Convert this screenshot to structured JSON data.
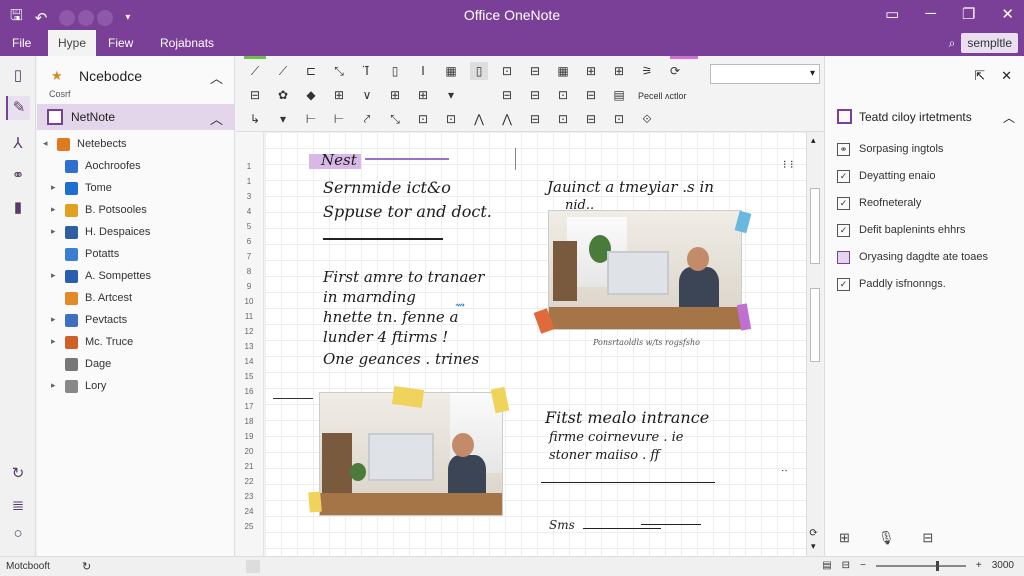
{
  "window": {
    "title": "Office OneNote",
    "qa_icons": [
      "save-icon",
      "undo-icon"
    ],
    "controls": [
      "restore-icon",
      "minimize-icon",
      "maximize-icon",
      "close-icon"
    ]
  },
  "menu": {
    "tabs": [
      {
        "label": "File",
        "active": false
      },
      {
        "label": "Hype",
        "active": true
      },
      {
        "label": "Fiew",
        "active": false
      },
      {
        "label": "Rojabnats",
        "active": false
      }
    ],
    "search_value": "sempltle"
  },
  "notebook_pane": {
    "header_name": "Ncebodce",
    "header_sub": "Cosrf",
    "selected": "NetNote",
    "tree": [
      {
        "label": "Netebects",
        "arrow": "◂",
        "color": "#e07a1f",
        "indent": 0
      },
      {
        "label": "Aochroofes",
        "arrow": "",
        "color": "#2f6fcf",
        "indent": 1
      },
      {
        "label": "Tome",
        "arrow": "▸",
        "color": "#1f6fd0",
        "indent": 1
      },
      {
        "label": "B. Potsooles",
        "arrow": "▸",
        "color": "#e0a020",
        "indent": 1
      },
      {
        "label": "H. Despaices",
        "arrow": "▸",
        "color": "#2f5f9f",
        "indent": 1
      },
      {
        "label": "Potatts",
        "arrow": "",
        "color": "#3a7fd0",
        "indent": 1
      },
      {
        "label": "A. Sompettes",
        "arrow": "▸",
        "color": "#2a5fb0",
        "indent": 1
      },
      {
        "label": "B. Artcest",
        "arrow": "",
        "color": "#e08a2a",
        "indent": 1
      },
      {
        "label": "Pevtacts",
        "arrow": "▸",
        "color": "#3f6fbf",
        "indent": 1
      },
      {
        "label": "Mc. Truce",
        "arrow": "▸",
        "color": "#d0602a",
        "indent": 1
      },
      {
        "label": "Dage",
        "arrow": "",
        "color": "#777777",
        "indent": 1
      },
      {
        "label": "Lory",
        "arrow": "▸",
        "color": "#888888",
        "indent": 1
      }
    ]
  },
  "ribbon": {
    "font_value": "",
    "label_1": "Pecell ʌctlor"
  },
  "canvas": {
    "line_numbers": [
      "1",
      "1",
      "3",
      "4",
      "5",
      "6",
      "7",
      "8",
      "9",
      "10",
      "11",
      "12",
      "13",
      "14",
      "15",
      "16",
      "17",
      "18",
      "19",
      "20",
      "21",
      "22",
      "23",
      "24",
      "25"
    ],
    "tag": "Nest",
    "note1": [
      "Sernmide ict&o",
      "Sppuse tor and doct."
    ],
    "note2": [
      "First amre to tranaer",
      "in marnding",
      "hnette tn. fenne a",
      "lunder 4 ftirms !",
      "One geances . trines"
    ],
    "note3": [
      "Jauinct a tmeyiar .s in",
      "nid.."
    ],
    "note4": [
      "Fitst mealo intrance",
      "firme coirnevure . ie",
      "stoner maiiso . ff"
    ],
    "caption": "Ponsrtaoldls w/ts rogsfsho",
    "footer": "Sms"
  },
  "right_panel": {
    "title": "Teatd ciloy irtetments",
    "items": [
      {
        "label": "Sorpasing ingtols",
        "icon": "link-icon"
      },
      {
        "label": "Deyatting enaio",
        "icon": "check-icon"
      },
      {
        "label": "Reofneteraly",
        "icon": "check-icon"
      },
      {
        "label": "Defit baplenints ehhrs",
        "icon": "check-icon"
      },
      {
        "label": "Oryasing dagdte ate toaes",
        "icon": "square-icon"
      },
      {
        "label": "Paddly isfnonngs.",
        "icon": "check-icon"
      }
    ]
  },
  "status": {
    "left": "Motcbooft",
    "zoom": "3000"
  }
}
